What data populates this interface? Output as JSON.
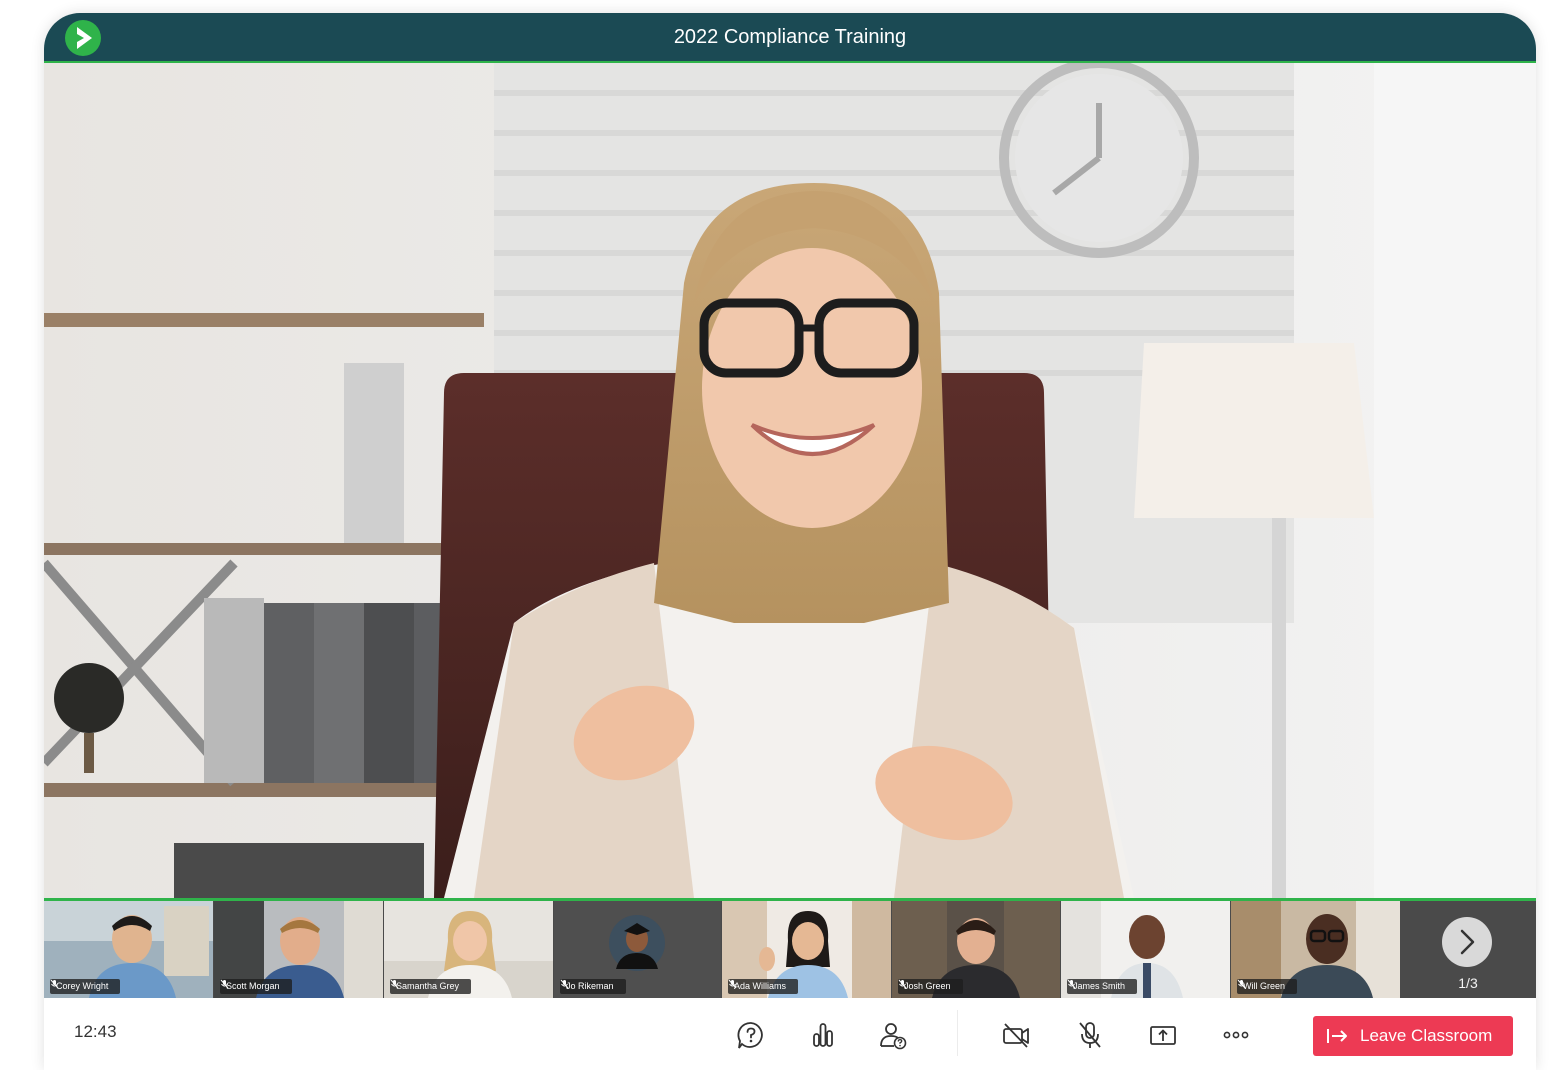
{
  "window": {
    "title": "2022 Compliance Training"
  },
  "participants": [
    {
      "name": "Corey Wright",
      "muted": true
    },
    {
      "name": "Scott Morgan",
      "muted": true
    },
    {
      "name": "Samantha Grey",
      "muted": true
    },
    {
      "name": "Jo Rikeman",
      "muted": true
    },
    {
      "name": "Ada Williams",
      "muted": true
    },
    {
      "name": "Josh Green",
      "muted": true
    },
    {
      "name": "James Smith",
      "muted": true
    },
    {
      "name": "Will Green",
      "muted": true
    }
  ],
  "pager": {
    "label": "1/3"
  },
  "toolbar": {
    "time": "12:43",
    "icons": [
      "question-icon",
      "poll-icon",
      "participants-question-icon",
      "camera-off-icon",
      "mic-off-icon",
      "share-screen-icon",
      "more-icon"
    ],
    "leave_label": "Leave Classroom"
  },
  "colors": {
    "titlebar": "#1b4a54",
    "accent_green": "#2fb34a",
    "leave_button": "#ed3a54"
  }
}
